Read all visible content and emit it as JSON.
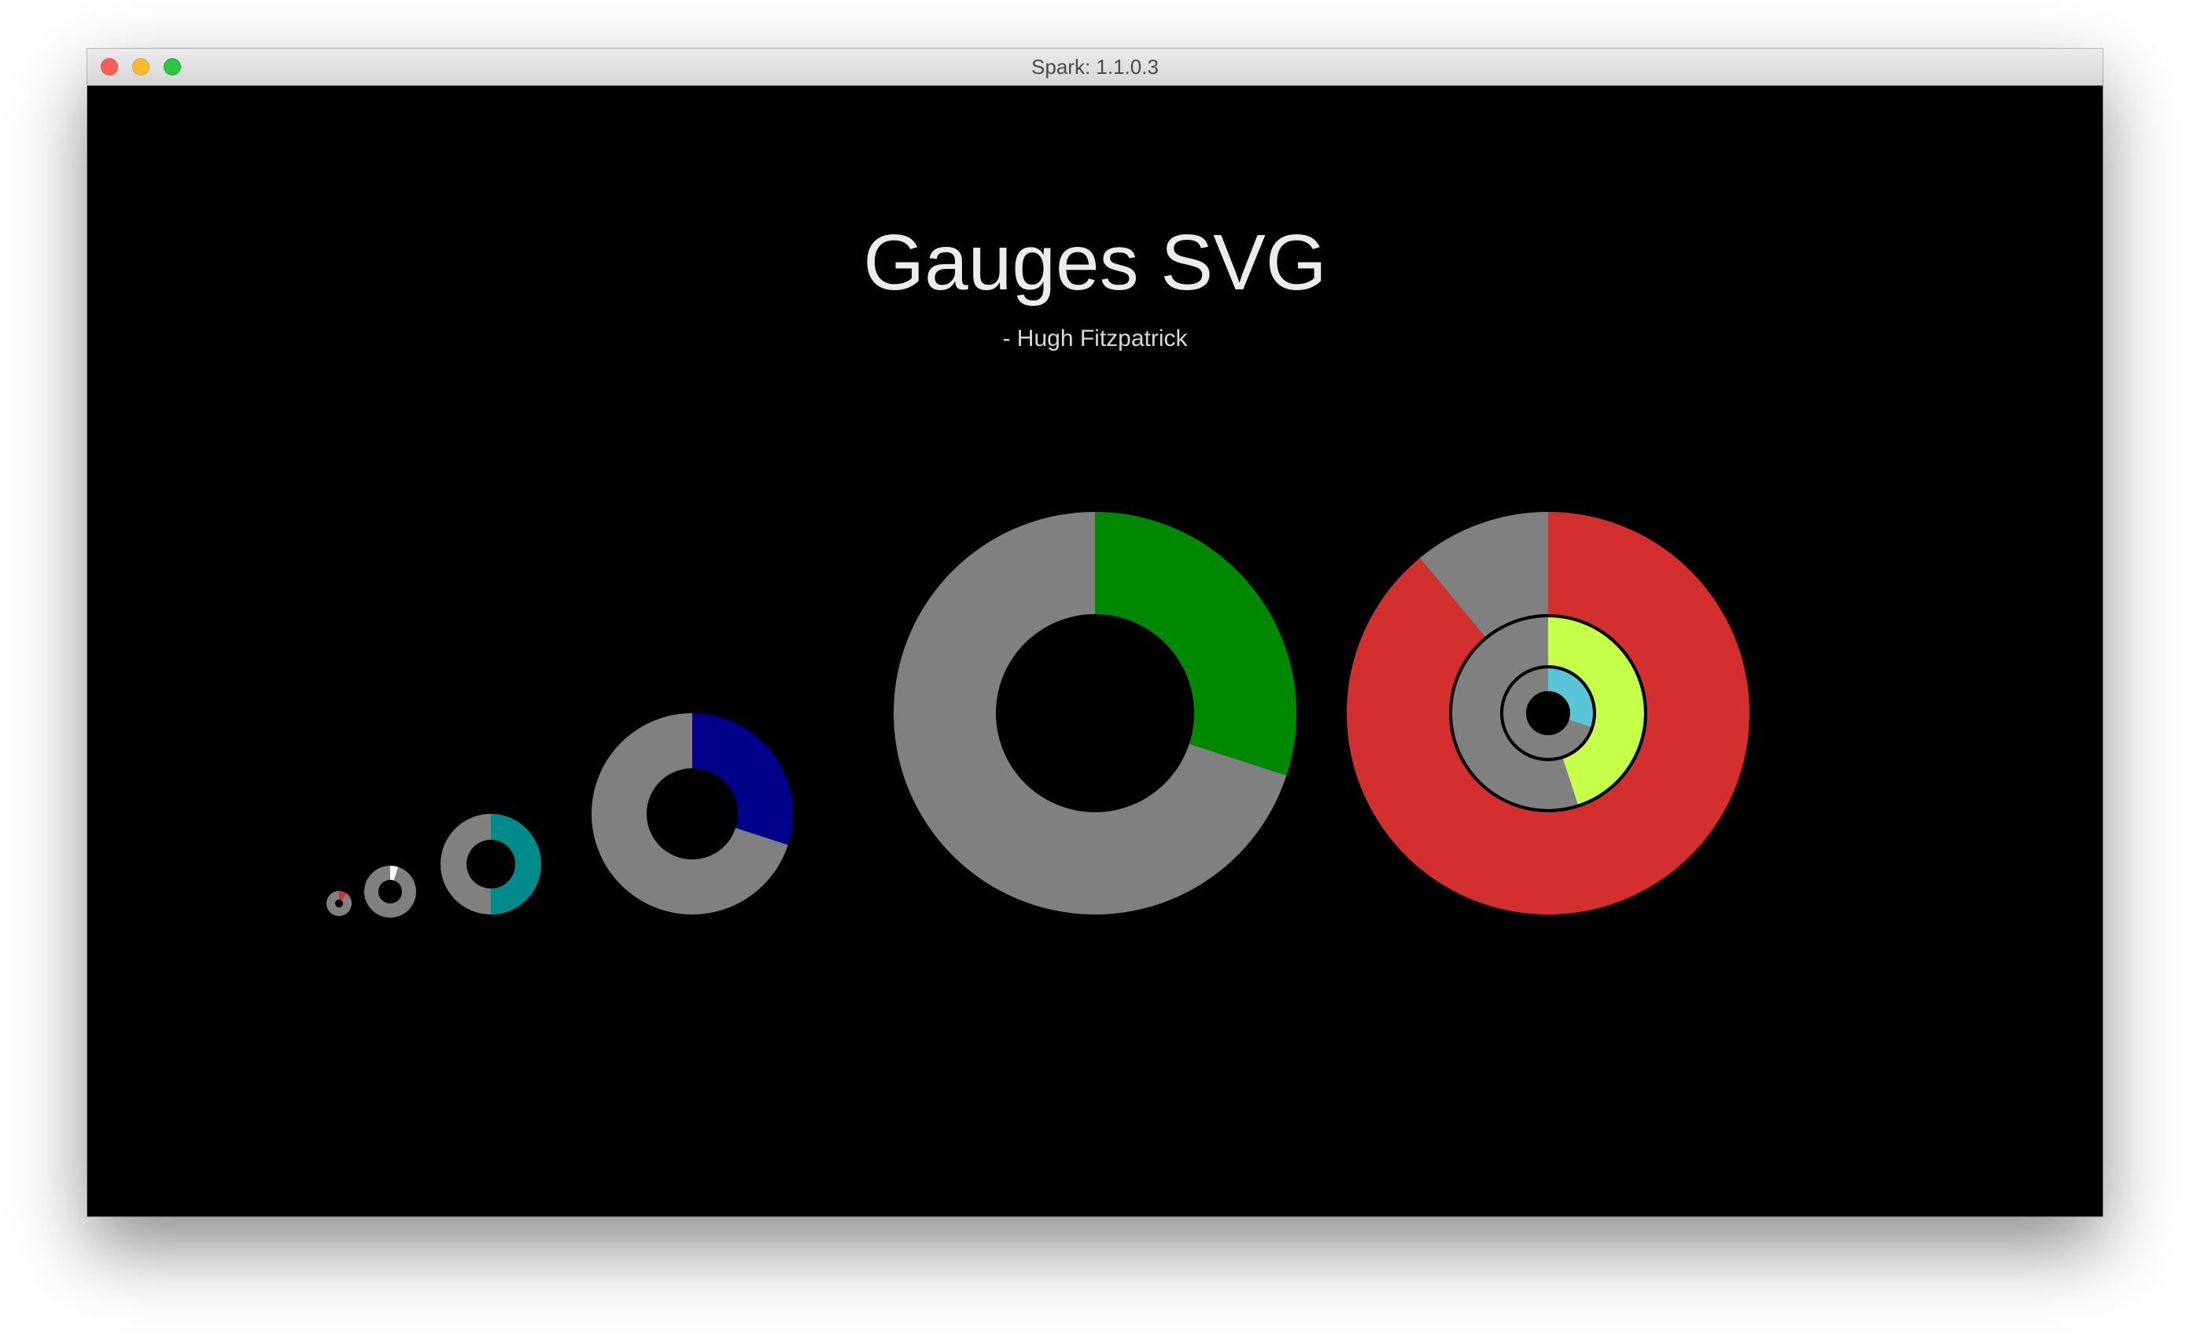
{
  "window": {
    "title": "Spark: 1.1.0.3"
  },
  "page": {
    "title": "Gauges SVG",
    "author": "- Hugh Fitzpatrick"
  },
  "colors": {
    "background": "#000000",
    "track": "#808080",
    "ring_outline": "#000000"
  },
  "chart_data": {
    "type": "gauge",
    "gauges": [
      {
        "name": "gauge-tiny",
        "value": 0.1,
        "color": "#d32f2f"
      },
      {
        "name": "gauge-small",
        "value": 0.05,
        "color": "#ffffff"
      },
      {
        "name": "gauge-teal",
        "value": 0.5,
        "color": "#008b8b"
      },
      {
        "name": "gauge-navy",
        "value": 0.3,
        "color": "#000088"
      },
      {
        "name": "gauge-green",
        "value": 0.3,
        "color": "#008800"
      },
      {
        "name": "gauge-nested",
        "rings": [
          {
            "value": 0.89,
            "color": "#d32f2f"
          },
          {
            "value": 0.45,
            "color": "#c6ff4a"
          },
          {
            "value": 0.3,
            "color": "#59c6d8"
          }
        ]
      }
    ]
  }
}
